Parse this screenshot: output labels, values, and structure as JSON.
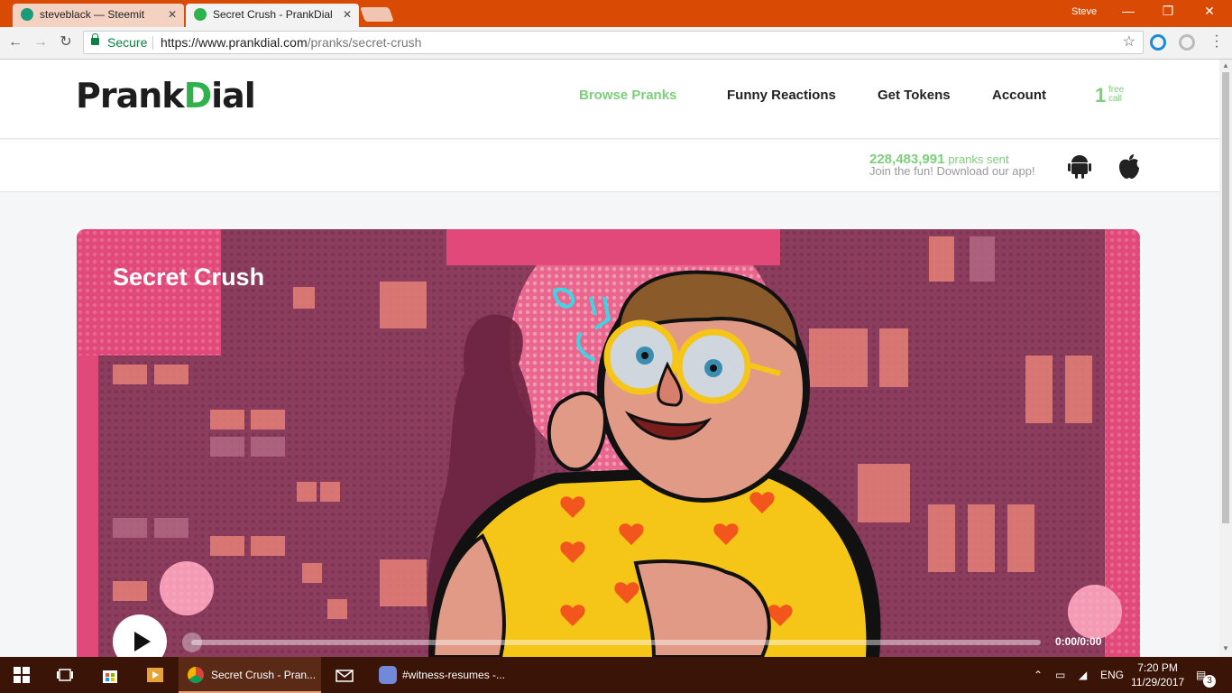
{
  "browser": {
    "tabs": [
      {
        "title": "steveblack — Steemit",
        "active": false
      },
      {
        "title": "Secret Crush - PrankDial",
        "active": true
      }
    ],
    "user": "Steve",
    "secure_label": "Secure",
    "url_host": "https://www.prankdial.com",
    "url_path": "/pranks/secret-crush"
  },
  "site": {
    "logo_left": "Prank",
    "logo_mid": "D",
    "logo_right": "ial",
    "nav": [
      "Browse Pranks",
      "Funny Reactions",
      "Get Tokens",
      "Account"
    ],
    "free_call_count": "1",
    "free_call_line1": "free",
    "free_call_line2": "call",
    "pranks_count": "228,483,991",
    "pranks_unit": "pranks sent",
    "join_text": "Join the fun! Download our app!",
    "accent_color": "#7ccf7a"
  },
  "hero": {
    "title": "Secret Crush",
    "time": "0:00/0:00",
    "progress": 0
  },
  "taskbar": {
    "items": [
      "Secret Crush - Pran...",
      "#witness-resumes -..."
    ],
    "lang": "ENG",
    "time": "7:20 PM",
    "date": "11/29/2017",
    "notifications": "3"
  }
}
